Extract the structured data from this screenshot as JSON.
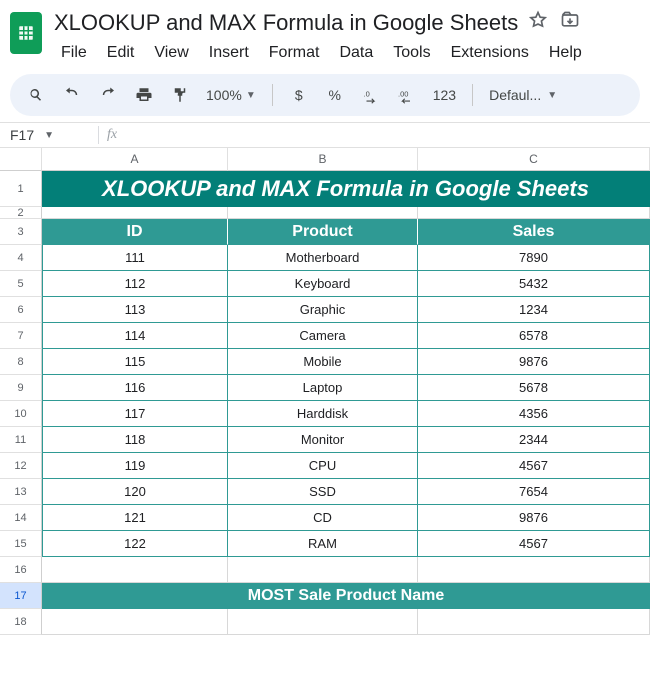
{
  "doc": {
    "title": "XLOOKUP and MAX Formula in Google Sheets"
  },
  "menus": [
    "File",
    "Edit",
    "View",
    "Insert",
    "Format",
    "Data",
    "Tools",
    "Extensions",
    "Help"
  ],
  "toolbar": {
    "zoom": "100%",
    "currency": "$",
    "percent": "%",
    "dec_dec": ".0",
    "inc_dec": ".00",
    "num_fmt": "123",
    "font": "Defaul..."
  },
  "namebox": "F17",
  "columns": [
    "A",
    "B",
    "C"
  ],
  "sheet": {
    "banner": "XLOOKUP and MAX Formula in Google Sheets",
    "headers": {
      "c1": "ID",
      "c2": "Product",
      "c3": "Sales"
    },
    "rows": [
      {
        "id": "111",
        "product": "Motherboard",
        "sales": "7890"
      },
      {
        "id": "112",
        "product": "Keyboard",
        "sales": "5432"
      },
      {
        "id": "113",
        "product": "Graphic",
        "sales": "1234"
      },
      {
        "id": "114",
        "product": "Camera",
        "sales": "6578"
      },
      {
        "id": "115",
        "product": "Mobile",
        "sales": "9876"
      },
      {
        "id": "116",
        "product": "Laptop",
        "sales": "5678"
      },
      {
        "id": "117",
        "product": "Harddisk",
        "sales": "4356"
      },
      {
        "id": "118",
        "product": "Monitor",
        "sales": "2344"
      },
      {
        "id": "119",
        "product": "CPU",
        "sales": "4567"
      },
      {
        "id": "120",
        "product": "SSD",
        "sales": "7654"
      },
      {
        "id": "121",
        "product": "CD",
        "sales": "9876"
      },
      {
        "id": "122",
        "product": "RAM",
        "sales": "4567"
      }
    ],
    "most_label": "MOST  Sale Product Name"
  },
  "row_numbers": [
    "1",
    "2",
    "3",
    "4",
    "5",
    "6",
    "7",
    "8",
    "9",
    "10",
    "11",
    "12",
    "13",
    "14",
    "15",
    "16",
    "17",
    "18"
  ]
}
